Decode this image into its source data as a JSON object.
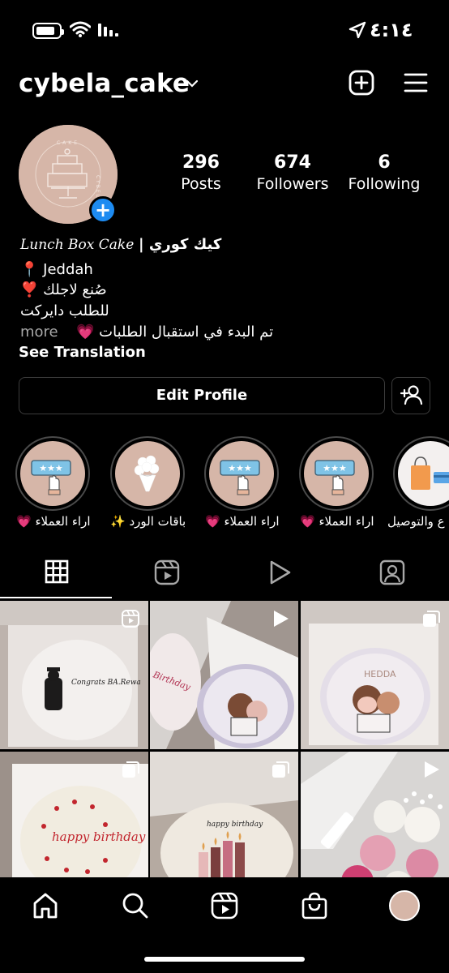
{
  "status_bar": {
    "time": "٤:١٤",
    "icons": [
      "battery-icon",
      "wifi-icon",
      "signal-icon",
      "location-arrow-icon"
    ]
  },
  "header": {
    "username": "cybela_cake",
    "icons": [
      "chevron-down-icon",
      "new-post-icon",
      "menu-icon"
    ]
  },
  "profile": {
    "avatar_logo_text": "CAKE CYBELA",
    "stats": [
      {
        "value": "296",
        "label": "Posts"
      },
      {
        "value": "674",
        "label": "Followers"
      },
      {
        "value": "6",
        "label": "Following"
      }
    ],
    "bio": {
      "name_latin": "Lunch Box Cake",
      "name_arabic": "| كيك كوري",
      "line1": "📍 Jeddah",
      "line2": "صُنع لاجلك ❣️",
      "line3": "للطلب دايركت",
      "line4": "تم البدء في استقبال الطلبات 💗",
      "more": "more",
      "see_translation": "See Translation"
    }
  },
  "buttons": {
    "edit_profile": "Edit Profile"
  },
  "highlights": [
    {
      "label": "اراء العملاء 💗",
      "icon": "rating-hand-icon"
    },
    {
      "label": "باقات الورد ✨",
      "icon": "flower-bouquet-icon"
    },
    {
      "label": "اراء العملاء 💗",
      "icon": "rating-hand-icon"
    },
    {
      "label": "اراء العملاء 💗",
      "icon": "rating-hand-icon"
    },
    {
      "label": "ع والتوصيل",
      "icon": "shopping-bag-icon"
    }
  ],
  "tabs": [
    "grid-icon",
    "reels-icon",
    "video-icon",
    "tagged-icon"
  ],
  "grid_posts": [
    {
      "type": "reel",
      "caption": "Congrats BA.Rewa",
      "theme": "graduation"
    },
    {
      "type": "video",
      "caption": "Birthday",
      "theme": "pink-sides"
    },
    {
      "type": "multiple",
      "caption": "HEDDA",
      "theme": "hug-girls"
    },
    {
      "type": "multiple",
      "caption": "happy birthday",
      "theme": "hearts"
    },
    {
      "type": "multiple",
      "caption": "happy birthday",
      "theme": "candles"
    },
    {
      "type": "video",
      "caption": "",
      "theme": "roses"
    }
  ],
  "bottom_nav": [
    "home-icon",
    "search-icon",
    "reels-icon",
    "shop-icon",
    "profile-avatar"
  ]
}
